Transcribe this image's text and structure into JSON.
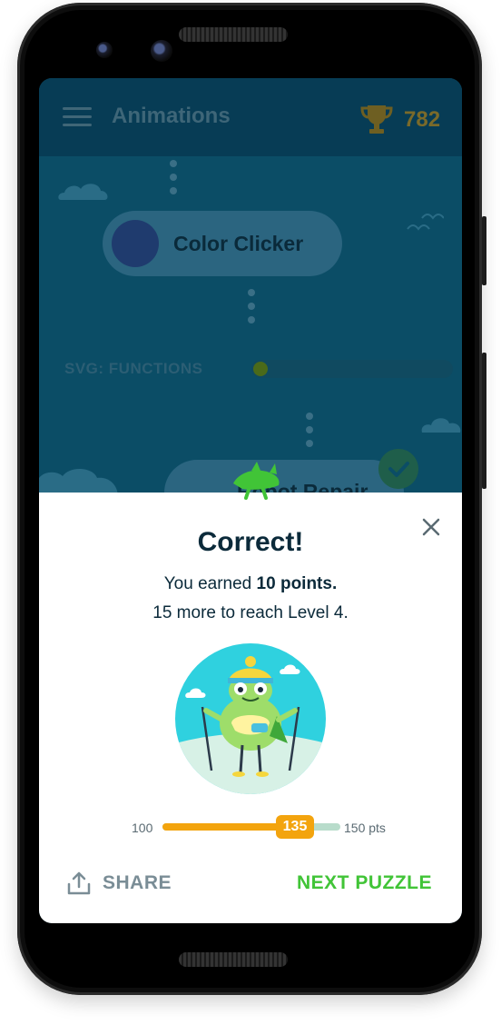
{
  "appbar": {
    "menu_icon": "hamburger-icon",
    "title": "Animations",
    "trophy_icon": "trophy-icon",
    "score": "782"
  },
  "path": {
    "node_color_clicker": "Color Clicker",
    "section_label": "SVG: FUNCTIONS",
    "node_robot_repair": "Robot Repair",
    "check_icon": "check-icon"
  },
  "dialog": {
    "close_icon": "close-icon",
    "heading": "Correct!",
    "earned_prefix": "You earned ",
    "earned_points": "10 points.",
    "level_text": "15 more to reach Level 4.",
    "progress": {
      "min_label": "100",
      "value": "135",
      "max_label": "150 pts",
      "fraction": 0.7
    },
    "share_label": "SHARE",
    "next_label": "NEXT PUZZLE"
  },
  "colors": {
    "accent_green": "#41c437",
    "progress_orange": "#f3a40e",
    "app_dark": "#073c55"
  }
}
